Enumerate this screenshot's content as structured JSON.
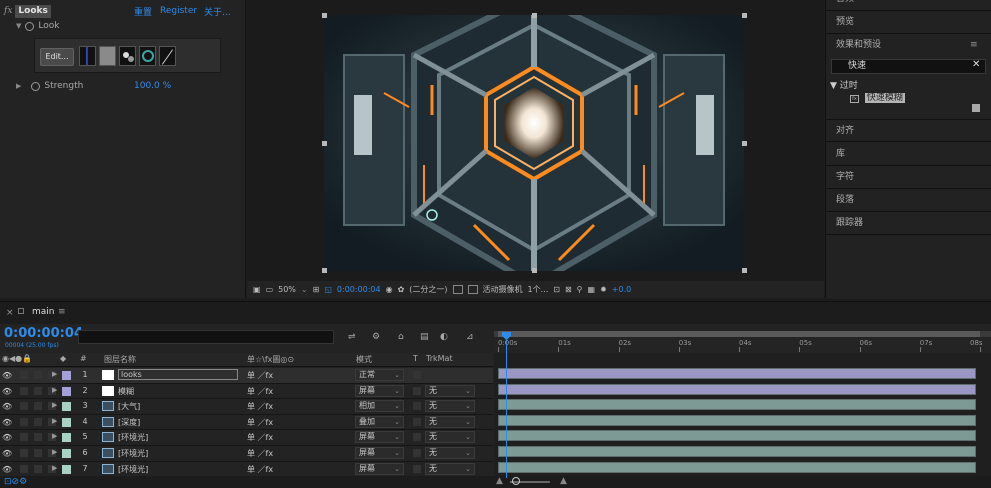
{
  "effect_controls": {
    "fx_label": "fx",
    "effect_name": "Looks",
    "reset_label": "重置",
    "register_label": "Register",
    "about_label": "关于...",
    "look_label": "Look",
    "edit_button": "Edit...",
    "strength_label": "Strength",
    "strength_value": "100.0 %"
  },
  "viewer": {
    "zoom": "50%",
    "timecode": "0:00:00:04",
    "resolution": "(二分之一)",
    "camera": "活动摄像机",
    "views": "1个...",
    "exposure": "+0.0"
  },
  "right_panel": {
    "items_top": [
      "音频",
      "预览",
      "效果和预设"
    ],
    "search_value": "快速",
    "tree_folder": "过时",
    "tree_effect": "快速模糊",
    "items_bottom": [
      "对齐",
      "库",
      "字符",
      "段落",
      "跟踪器"
    ]
  },
  "timeline": {
    "comp_name": "main",
    "timecode": "0:00:00:04",
    "fps": "00004 (25.00 fps)",
    "columns": {
      "name": "图层名称",
      "switches": "单☆\\fx圖◎⊙",
      "mode": "模式",
      "t": "T",
      "trkmat": "TrkMat"
    },
    "ruler_labels": [
      "0:00s",
      "01s",
      "02s",
      "03s",
      "04s",
      "05s",
      "06s",
      "07s",
      "08s"
    ],
    "layers": [
      {
        "num": "1",
        "name": "looks",
        "mode": "正常",
        "trkmat": "",
        "label_color": "#a5a1d6",
        "bar_color": "#9b97c4",
        "source": "solid-white"
      },
      {
        "num": "2",
        "name": "模糊",
        "mode": "屏幕",
        "trkmat": "无",
        "label_color": "#a5a1d6",
        "bar_color": "#9b97c4",
        "source": "solid-white"
      },
      {
        "num": "3",
        "name": "[大气]",
        "mode": "相加",
        "trkmat": "无",
        "label_color": "#a8d2c4",
        "bar_color": "#7d9b94",
        "source": "comp"
      },
      {
        "num": "4",
        "name": "[深度]",
        "mode": "叠加",
        "trkmat": "无",
        "label_color": "#a8d2c4",
        "bar_color": "#7d9b94",
        "source": "comp"
      },
      {
        "num": "5",
        "name": "[环境光]",
        "mode": "屏幕",
        "trkmat": "无",
        "label_color": "#a8d2c4",
        "bar_color": "#7d9b94",
        "source": "comp"
      },
      {
        "num": "6",
        "name": "[环境光]",
        "mode": "屏幕",
        "trkmat": "无",
        "label_color": "#a8d2c4",
        "bar_color": "#7d9b94",
        "source": "comp"
      },
      {
        "num": "7",
        "name": "[环境光]",
        "mode": "屏幕",
        "trkmat": "无",
        "label_color": "#a8d2c4",
        "bar_color": "#7d9b94",
        "source": "comp"
      }
    ]
  },
  "colors": {
    "accent": "#2d8ceb",
    "glow": "#ff8a1e"
  }
}
